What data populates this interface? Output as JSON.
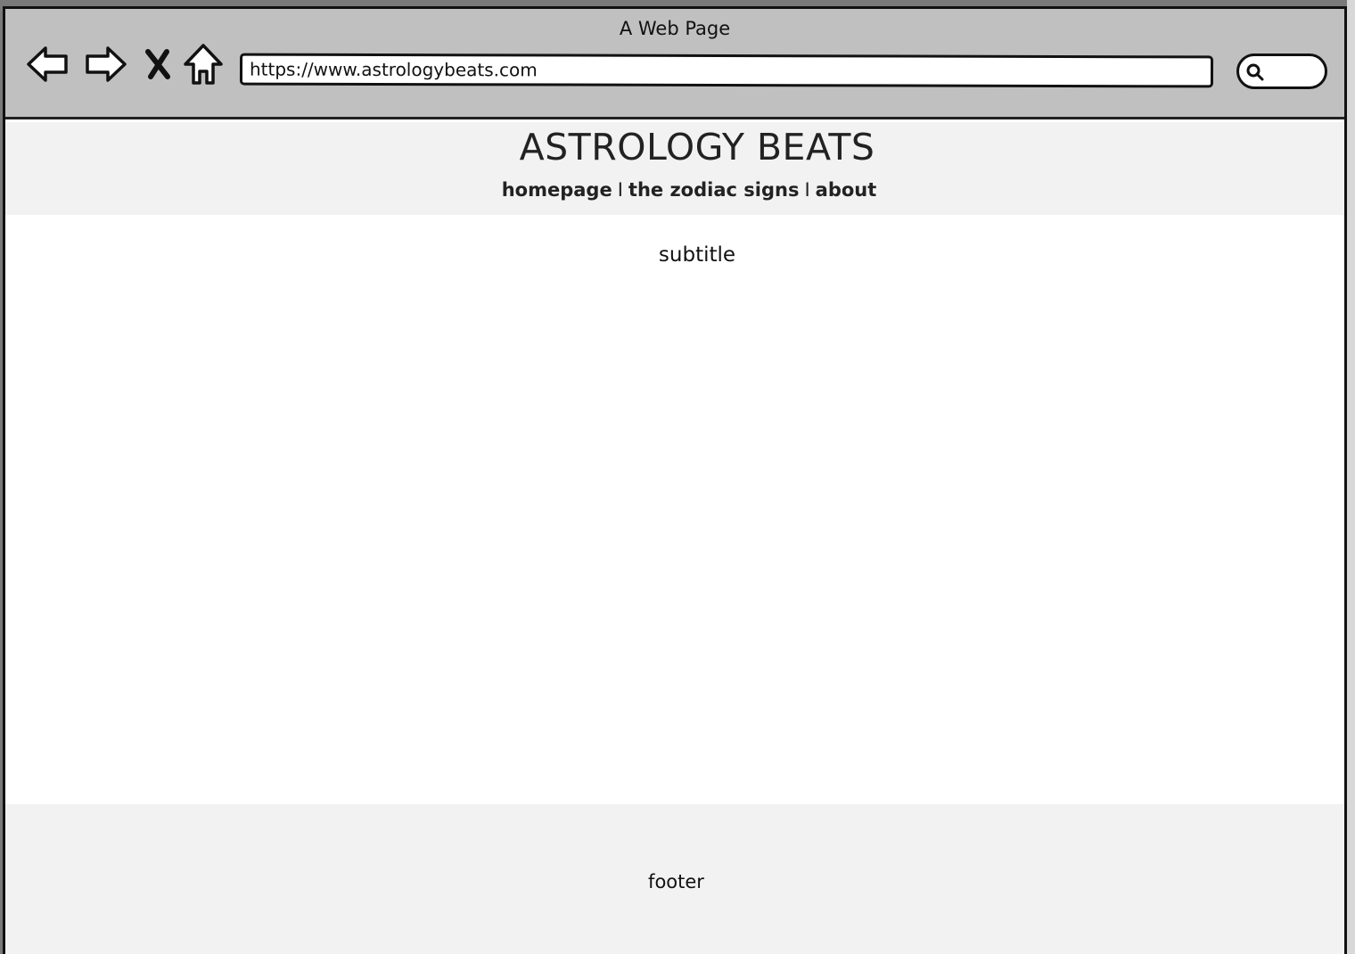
{
  "window": {
    "title": "A Web Page"
  },
  "toolbar": {
    "back_icon": "back-arrow-icon",
    "forward_icon": "forward-arrow-icon",
    "stop_icon": "close-x-icon",
    "home_icon": "home-icon",
    "url": "https://www.astrologybeats.com",
    "search_icon": "magnifier-icon"
  },
  "header": {
    "title": "ASTROLOGY BEATS",
    "nav": [
      {
        "label": "homepage"
      },
      {
        "label": "the zodiac signs"
      },
      {
        "label": "about"
      }
    ],
    "separator": "I"
  },
  "main": {
    "subtitle": "subtitle"
  },
  "footer": {
    "text": "footer"
  },
  "colors": {
    "chrome": "#c0c0c0",
    "header_bg": "#f2f2f2",
    "footer_bg": "#f2f2f2",
    "outline": "#111111"
  }
}
